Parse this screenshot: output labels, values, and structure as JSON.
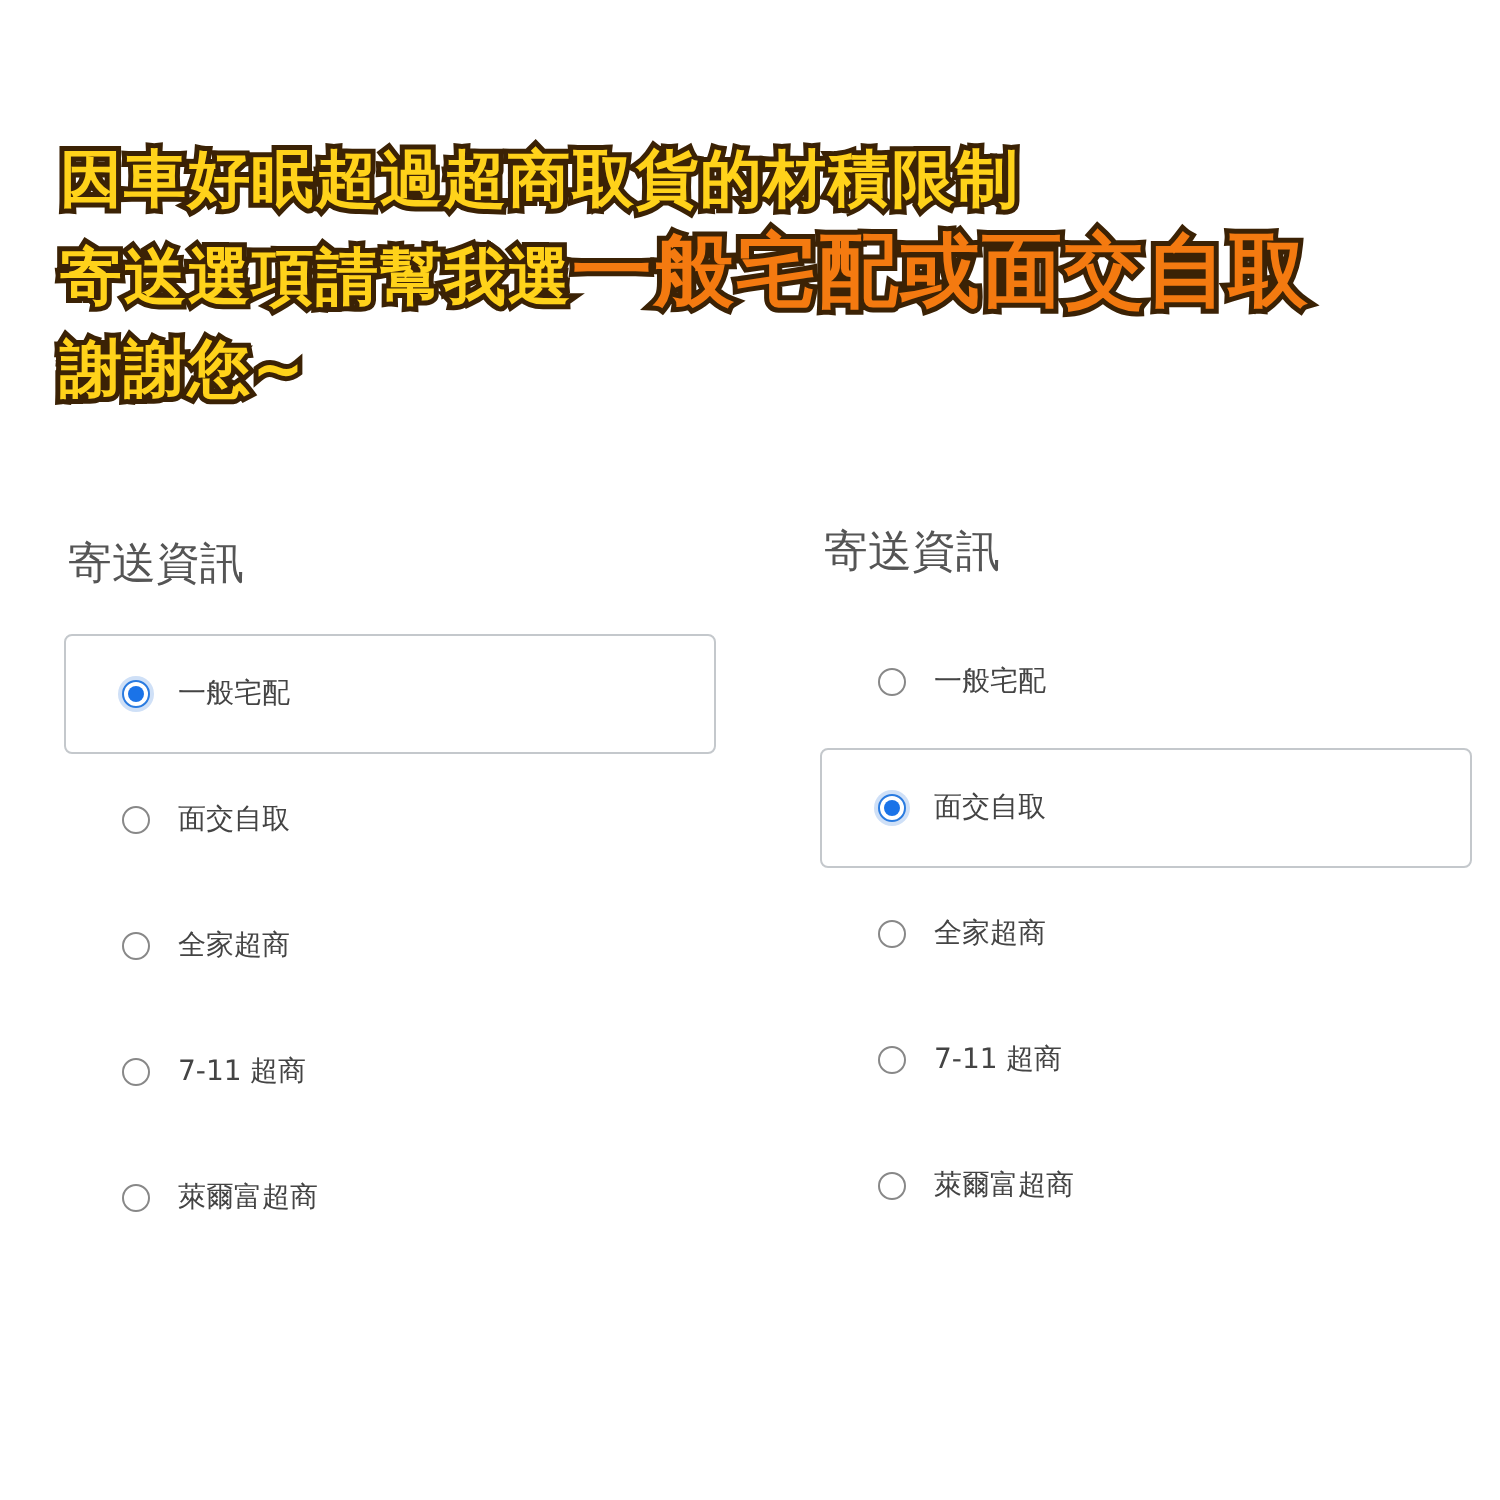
{
  "banner": {
    "lines": [
      {
        "segments": [
          {
            "text": "因車好眠超過超商取貨的材積限制",
            "kind": "plain"
          }
        ]
      },
      {
        "segments": [
          {
            "text": "寄送選項請幫我選",
            "kind": "plain"
          },
          {
            "text": "一般宅配或面交自取",
            "kind": "highlight"
          }
        ]
      },
      {
        "segments": [
          {
            "text": "謝謝您~",
            "kind": "plain"
          }
        ]
      }
    ]
  },
  "panels": [
    {
      "title": "寄送資訊",
      "options": [
        {
          "label": "一般宅配",
          "selected": true
        },
        {
          "label": "面交自取",
          "selected": false
        },
        {
          "label": "全家超商",
          "selected": false
        },
        {
          "label": "7-11 超商",
          "selected": false
        },
        {
          "label": "萊爾富超商",
          "selected": false
        }
      ]
    },
    {
      "title": "寄送資訊",
      "options": [
        {
          "label": "一般宅配",
          "selected": false
        },
        {
          "label": "面交自取",
          "selected": true
        },
        {
          "label": "全家超商",
          "selected": false
        },
        {
          "label": "7-11 超商",
          "selected": false
        },
        {
          "label": "萊爾富超商",
          "selected": false
        }
      ]
    }
  ]
}
